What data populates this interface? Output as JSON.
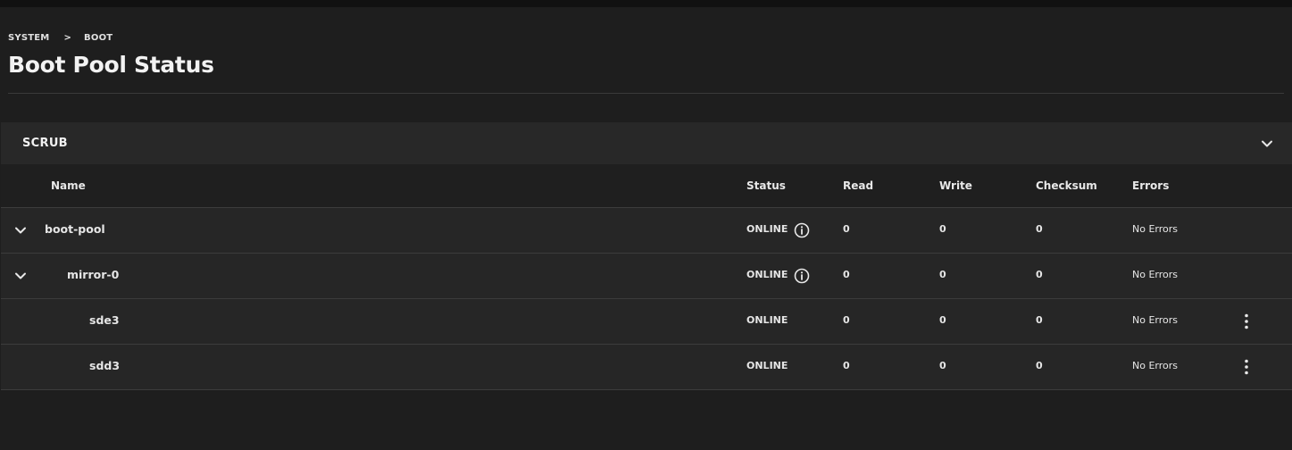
{
  "breadcrumb": {
    "items": [
      "SYSTEM",
      "BOOT"
    ],
    "separator": ">"
  },
  "page": {
    "title": "Boot Pool Status"
  },
  "card": {
    "title": "SCRUB",
    "collapse_icon": "chevron-down-icon"
  },
  "table": {
    "columns": [
      "Name",
      "Status",
      "Read",
      "Write",
      "Checksum",
      "Errors"
    ],
    "rows": [
      {
        "name": "boot-pool",
        "status": "ONLINE",
        "read": "0",
        "write": "0",
        "checksum": "0",
        "errors": "No Errors"
      },
      {
        "name": "mirror-0",
        "status": "ONLINE",
        "read": "0",
        "write": "0",
        "checksum": "0",
        "errors": "No Errors"
      },
      {
        "name": "sde3",
        "status": "ONLINE",
        "read": "0",
        "write": "0",
        "checksum": "0",
        "errors": "No Errors"
      },
      {
        "name": "sdd3",
        "status": "ONLINE",
        "read": "0",
        "write": "0",
        "checksum": "0",
        "errors": "No Errors"
      }
    ]
  },
  "colors": {
    "background": "#1e1e1e",
    "row": "#262626",
    "card_header": "#282828",
    "border": "#3c3c3c",
    "text": "#e6e6e6"
  }
}
